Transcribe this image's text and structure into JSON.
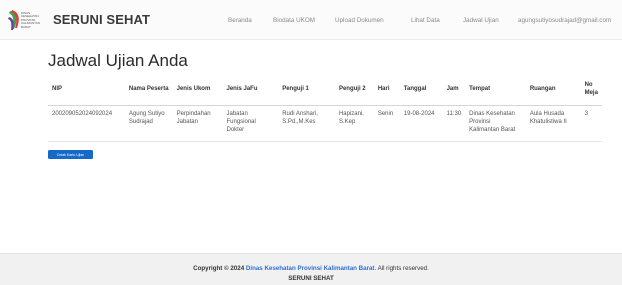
{
  "brand": {
    "logo_text": [
      "DINAS",
      "KESEHATAN",
      "PROVINSI",
      "KALIMANTAN",
      "BARAT"
    ],
    "title": "SERUNI SEHAT",
    "colors": {
      "ribbon_green": "#3aa64a",
      "ribbon_red": "#e23b3b",
      "ribbon_purple": "#6b3fa0"
    }
  },
  "nav": {
    "items": [
      {
        "label": "Beranda"
      },
      {
        "label": "Biodata UKOM"
      },
      {
        "label": "Upload Dokumen"
      },
      {
        "label": "Lihat Data"
      },
      {
        "label": "Jadwal Ujian"
      },
      {
        "label": "agungsutiyosudrajad@gmail.com"
      }
    ]
  },
  "main": {
    "title": "Jadwal Ujian Anda",
    "table": {
      "headers": [
        "NIP",
        "Nama Peserta",
        "Jenis Ukom",
        "Jenis JaFu",
        "Penguji 1",
        "Penguji 2",
        "Hari",
        "Tanggal",
        "Jam",
        "Tempat",
        "Ruangan",
        "No Meja"
      ],
      "rows": [
        [
          "200209052024092024",
          "Agung Sutiyo Sudrajad",
          "Perpindahan Jabatan",
          "Jabatan Fungsional Dokter",
          "Rudi Anshari, S.Pd.,M.Kes",
          "Hapizani, S.Kep",
          "Senin",
          "19-08-2024",
          "11:30",
          "Dinas Kesehatan Provinsi Kalimantan Barat",
          "Aula Husada Khatulistiwa II",
          "3"
        ]
      ]
    },
    "print_button": "Cetak Kartu Ujian",
    "accent": "#1469c9"
  },
  "footer": {
    "copyright_prefix": "Copyright © 2024",
    "org_link": "Dinas Kesehatan Provinsi Kalimantan Barat",
    "suffix": ". All rights reserved.",
    "app_name": "SERUNI SEHAT"
  }
}
